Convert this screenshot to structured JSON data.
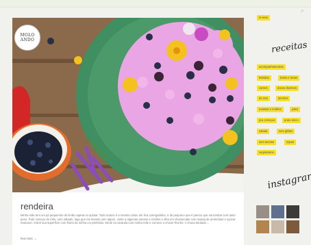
{
  "search": {
    "icon": "search-icon",
    "glyph": "⌕"
  },
  "logo": {
    "line1": "MOLO",
    "line2": "ANDO"
  },
  "post": {
    "title": "rendeira",
    "excerpt": "Minha mãe tem um pé pequenino de limão capeta no quintal. Todo outono é a mesma coisa: ele fica carregadinho, e de pequeno que é parece que vai tombar com tanto peso. Todo começo de mês, num sábado, lago que me levanto vem algum. Junte a algumas amoras e mirtilos e olha um cheesecake com massa de amêndoas e açúcar mascavo. Colori sua superfície com flores da minha cor preferida. Sente na varanda com minha mãe e comece a chover-fininho. A chuva bordado ...",
    "more": "leia mais →"
  },
  "sidebar": {
    "top_tag": "re-sete",
    "receitas_title": "receitas",
    "tags": [
      "acompanhamentos",
      "bebidas",
      "bolos e tortas",
      "carnes",
      "doces diversos",
      "do mar",
      "lanches",
      "massas e molhos",
      "pães",
      "pra começar",
      "prato único",
      "salada",
      "sem glúten",
      "sem lactose",
      "sopas",
      "vegetariano"
    ],
    "instagram_title": "instagram"
  },
  "colors": {
    "tag_yellow": "#f7df2e",
    "cake_pink": "#e9a5e4",
    "plate_green": "#4c9a6a"
  }
}
